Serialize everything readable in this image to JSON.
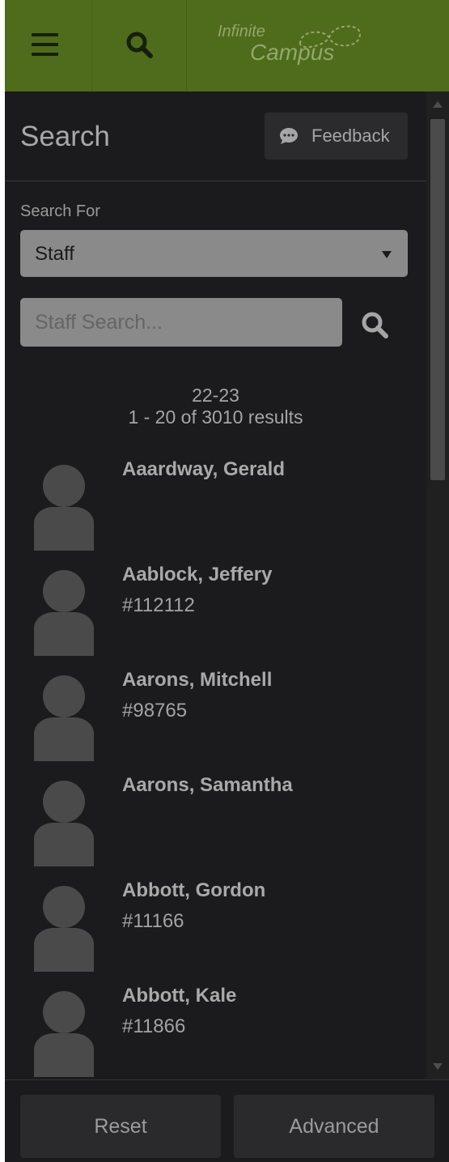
{
  "header": {
    "menu_icon": "hamburger-icon",
    "search_icon": "search-icon",
    "logo": {
      "line1": "Infinite",
      "line2": "Campus"
    }
  },
  "panel": {
    "title": "Search",
    "feedback_label": "Feedback",
    "search_for_label": "Search For",
    "search_for_value": "Staff",
    "search_placeholder": "Staff Search...",
    "school_year": "22-23",
    "results_summary": "1 - 20 of 3010 results"
  },
  "results": [
    {
      "name": "Aaardway, Gerald",
      "id": ""
    },
    {
      "name": "Aablock, Jeffery",
      "id": "#112112"
    },
    {
      "name": "Aarons, Mitchell",
      "id": "#98765"
    },
    {
      "name": "Aarons, Samantha",
      "id": ""
    },
    {
      "name": "Abbott, Gordon",
      "id": "#11166"
    },
    {
      "name": "Abbott, Kale",
      "id": "#11866"
    }
  ],
  "footer": {
    "reset_label": "Reset",
    "advanced_label": "Advanced"
  },
  "colors": {
    "header_bg": "#4f6b1c",
    "panel_bg": "#1b1b1d",
    "field_bg": "#8a8a8a"
  }
}
